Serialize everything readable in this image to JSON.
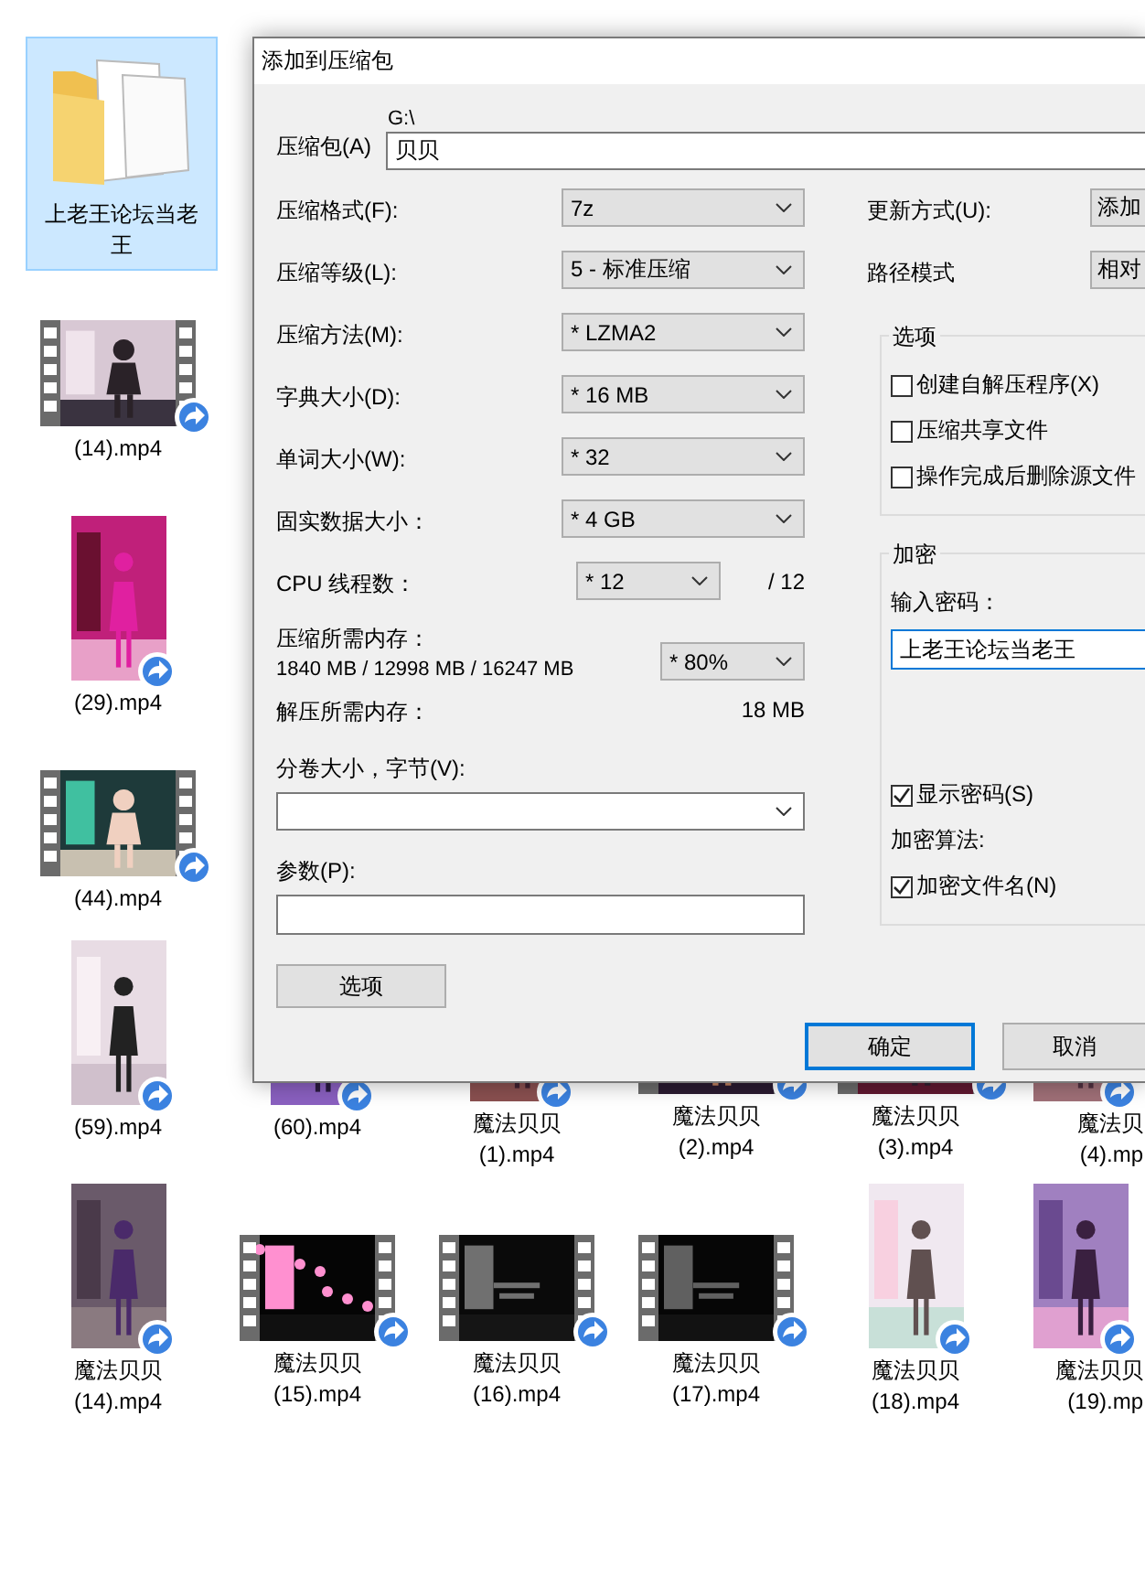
{
  "explorer": {
    "left_column": [
      {
        "kind": "folder",
        "label": "上老王论坛当老王",
        "selected": true
      },
      {
        "kind": "video",
        "label": "(14).mp4",
        "selected": false
      },
      {
        "kind": "portrait",
        "label": "(29).mp4",
        "selected": false
      },
      {
        "kind": "video",
        "label": "(44).mp4",
        "selected": false
      }
    ],
    "rows": [
      [
        {
          "kind": "portrait",
          "label": "(59).mp4",
          "selected": false
        },
        {
          "kind": "portrait",
          "label": "(60).mp4",
          "selected": false
        },
        {
          "kind": "portrait",
          "label": "魔法贝贝\n(1).mp4",
          "selected": false
        },
        {
          "kind": "video",
          "label": "魔法贝贝\n(2).mp4",
          "selected": false
        },
        {
          "kind": "video",
          "label": "魔法贝贝\n(3).mp4",
          "selected": false
        },
        {
          "kind": "portrait",
          "label": "魔法贝\n(4).mp",
          "selected": false
        }
      ],
      [
        {
          "kind": "portrait",
          "label": "魔法贝贝\n(14).mp4",
          "selected": false
        },
        {
          "kind": "video",
          "label": "魔法贝贝\n(15).mp4",
          "selected": false
        },
        {
          "kind": "video",
          "label": "魔法贝贝\n(16).mp4",
          "selected": false
        },
        {
          "kind": "video",
          "label": "魔法贝贝\n(17).mp4",
          "selected": false
        },
        {
          "kind": "portrait",
          "label": "魔法贝贝\n(18).mp4",
          "selected": false
        },
        {
          "kind": "portrait",
          "label": "魔法贝贝\n(19).mp",
          "selected": false
        }
      ]
    ]
  },
  "dialog": {
    "title": "添加到压缩包",
    "archive": {
      "label": "压缩包(A)",
      "folder": "G:\\",
      "value": "贝贝"
    },
    "settings": [
      {
        "label": "压缩格式(F):",
        "value": "7z"
      },
      {
        "label": "压缩等级(L):",
        "value": "5 - 标准压缩"
      },
      {
        "label": "压缩方法(M):",
        "value": "* LZMA2"
      },
      {
        "label": "字典大小(D):",
        "value": "* 16 MB"
      },
      {
        "label": "单词大小(W):",
        "value": "* 32"
      },
      {
        "label": "固实数据大小：",
        "value": "* 4 GB"
      }
    ],
    "cpu": {
      "label": "CPU 线程数：",
      "value": "* 12",
      "max": "/ 12"
    },
    "memory": {
      "label": "压缩所需内存：",
      "detail": "1840 MB / 12998 MB / 16247 MB",
      "value": "* 80%"
    },
    "decompress": {
      "label": "解压所需内存：",
      "value": "18 MB"
    },
    "split": {
      "label": "分卷大小，字节(V):"
    },
    "params": {
      "label": "参数(P):"
    },
    "options_button": "选项",
    "update": {
      "label": "更新方式(U):",
      "value": "添加"
    },
    "path_mode": {
      "label": "路径模式",
      "value": "相对"
    },
    "options_group": {
      "title": "选项",
      "checkboxes": [
        {
          "label": "创建自解压程序(X)",
          "checked": false
        },
        {
          "label": "压缩共享文件",
          "checked": false
        },
        {
          "label": "操作完成后删除源文件",
          "checked": false
        }
      ]
    },
    "encryption": {
      "title": "加密",
      "password_label": "输入密码：",
      "password": "上老王论坛当老王",
      "items": [
        {
          "kind": "checkbox",
          "label": "显示密码(S)",
          "checked": true
        },
        {
          "kind": "label",
          "label": "加密算法:"
        },
        {
          "kind": "checkbox",
          "label": "加密文件名(N)",
          "checked": true
        }
      ]
    },
    "buttons": [
      {
        "label": "确定",
        "default": true
      },
      {
        "label": "取消",
        "default": false
      }
    ]
  }
}
